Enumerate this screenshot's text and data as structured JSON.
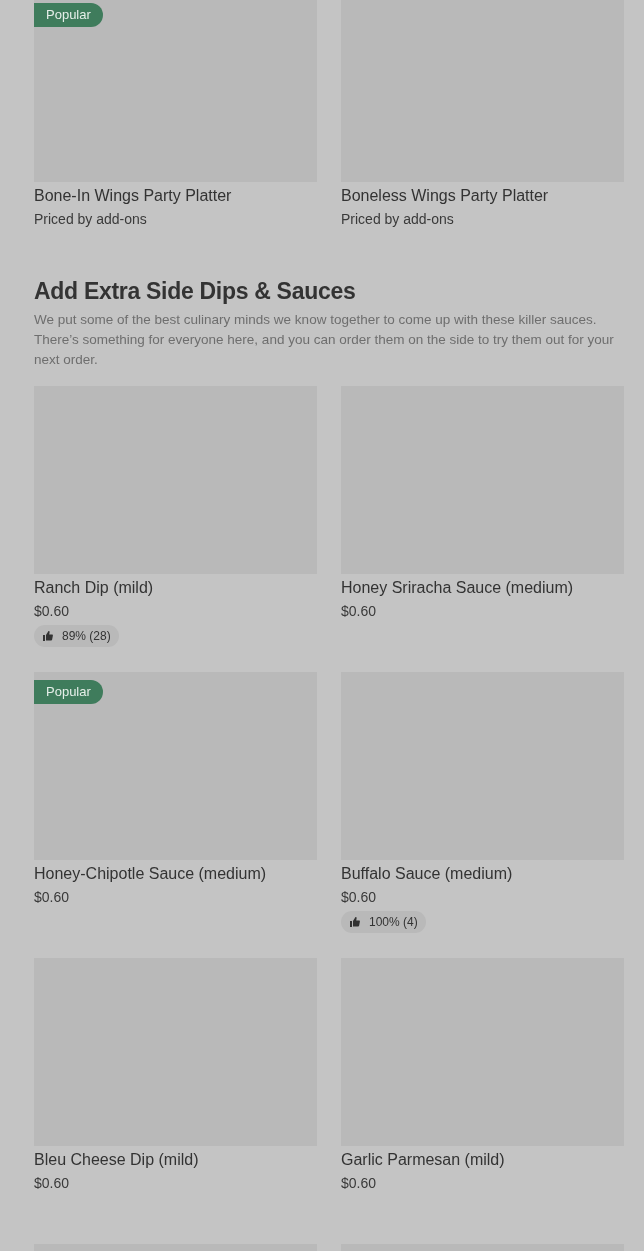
{
  "top_items": [
    {
      "name": "Bone-In Wings Party Platter",
      "price": "Priced by add-ons",
      "badge": "Popular"
    },
    {
      "name": "Boneless Wings Party Platter",
      "price": "Priced by add-ons"
    }
  ],
  "section": {
    "title": "Add Extra Side Dips & Sauces",
    "description": "We put some of the best culinary minds we know together to come up with these killer sauces. There’s something for everyone here, and you can order them on the side to try them out for your next order.",
    "items": [
      {
        "name": "Ranch Dip (mild)",
        "price": "$0.60",
        "rating": "89% (28)"
      },
      {
        "name": "Honey Sriracha Sauce (medium)",
        "price": "$0.60"
      },
      {
        "name": "Honey-Chipotle Sauce (medium)",
        "price": "$0.60",
        "badge": "Popular"
      },
      {
        "name": "Buffalo Sauce (medium)",
        "price": "$0.60",
        "rating": "100% (4)"
      },
      {
        "name": "Bleu Cheese Dip (mild)",
        "price": "$0.60"
      },
      {
        "name": "Garlic Parmesan (mild)",
        "price": "$0.60"
      }
    ],
    "cut_items": [
      {
        "kind": "image"
      },
      {
        "kind": "image"
      }
    ]
  }
}
